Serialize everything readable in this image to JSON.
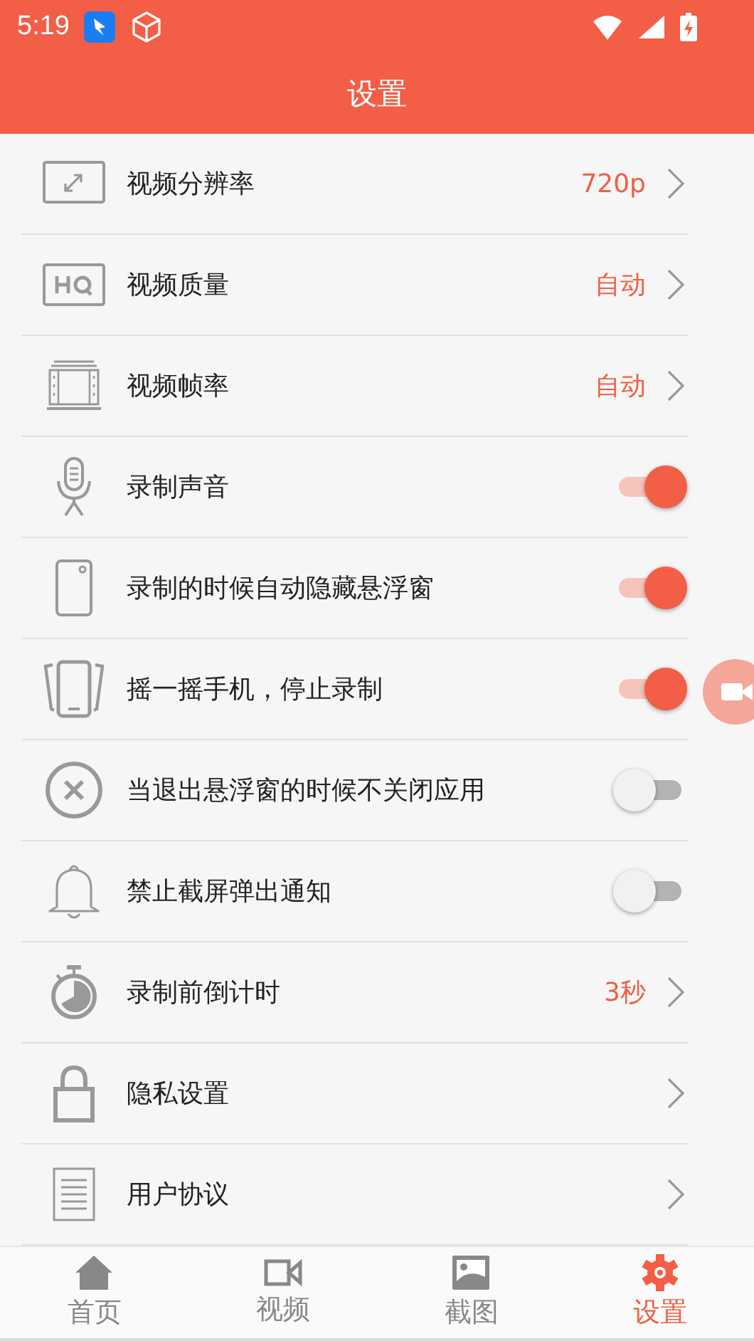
{
  "status_bar": {
    "time": "5:19"
  },
  "title": "设置",
  "settings": [
    {
      "kind": "value",
      "label": "视频分辨率",
      "value": "720p"
    },
    {
      "kind": "value",
      "label": "视频质量",
      "value": "自动"
    },
    {
      "kind": "value",
      "label": "视频帧率",
      "value": "自动"
    },
    {
      "kind": "toggle",
      "label": "录制声音",
      "on": true
    },
    {
      "kind": "toggle",
      "label": "录制的时候自动隐藏悬浮窗",
      "on": true
    },
    {
      "kind": "toggle",
      "label": "摇一摇手机，停止录制",
      "on": true
    },
    {
      "kind": "toggle",
      "label": "当退出悬浮窗的时候不关闭应用",
      "on": false
    },
    {
      "kind": "toggle",
      "label": "禁止截屏弹出通知",
      "on": false
    },
    {
      "kind": "value",
      "label": "录制前倒计时",
      "value": "3秒"
    },
    {
      "kind": "link",
      "label": "隐私设置"
    },
    {
      "kind": "link",
      "label": "用户协议"
    }
  ],
  "tabs": [
    {
      "label": "首页",
      "selected": false
    },
    {
      "label": "视频",
      "selected": false
    },
    {
      "label": "截图",
      "selected": false
    },
    {
      "label": "设置",
      "selected": true
    }
  ]
}
